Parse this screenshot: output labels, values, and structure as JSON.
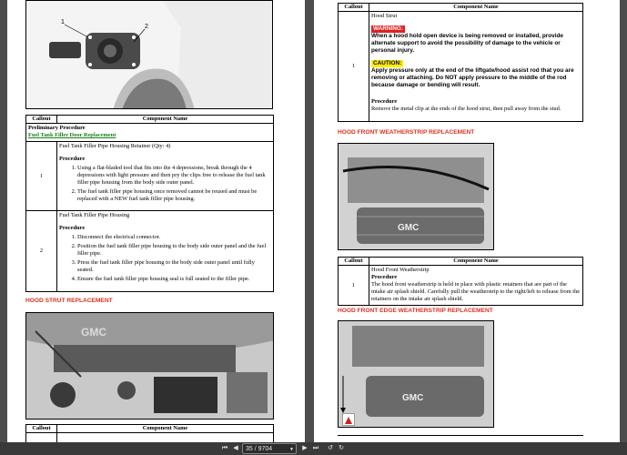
{
  "left_page": {
    "table1": {
      "headers": [
        "Callout",
        "Component Name"
      ],
      "preliminary_label": "Preliminary Procedure",
      "preliminary_link": "Fuel Tank Filler Door Replacement",
      "rows": [
        {
          "callout": "1",
          "component": "Fuel Tank Filler Pipe Housing Retainer (Qty: 4)",
          "procedure_label": "Procedure",
          "steps": [
            "Using a flat-bladed tool that fits into the 4 depressions, break through the 4 depressions with light pressure and then pry the clips free to release the fuel tank filler pipe housing from the body side outer panel.",
            "The fuel tank filler pipe housing once removed cannot be reused and must be replaced with a NEW fuel tank filler pipe housing."
          ]
        },
        {
          "callout": "2",
          "component": "Fuel Tank Filler Pipe Housing",
          "procedure_label": "Procedure",
          "steps": [
            "Disconnect the electrical connector.",
            "Position the fuel tank filler pipe housing to the body side outer panel and the fuel filler pipe.",
            "Press the fuel tank filler pipe housing to the body side outer panel until fully seated.",
            "Ensure the fuel tank filler pipe housing seal is full seated to the filler pipe."
          ]
        }
      ]
    },
    "section_hood_strut": "HOOD STRUT REPLACEMENT",
    "table2": {
      "headers": [
        "Callout",
        "Component Name"
      ]
    }
  },
  "right_page": {
    "table_strut": {
      "headers": [
        "Callout",
        "Component Name"
      ],
      "callout": "1",
      "component": "Hood Strut",
      "warning_label": "WARNING:",
      "warning_text": "When a hood hold open device is being removed or installed, provide alternate support to avoid the possibility of damage to the vehicle or personal injury.",
      "caution_label": "CAUTION:",
      "caution_text": "Apply pressure only at the end of the liftgate/hood assist rod that you are removing or attaching. Do NOT apply pressure to the middle of the rod because damage or bending will result.",
      "procedure_label": "Procedure",
      "procedure_text": "Remove the metal clip at the ends of the hood strut, then pull away from the stud."
    },
    "section_weatherstrip": "HOOD FRONT WEATHERSTRIP REPLACEMENT",
    "table_weatherstrip": {
      "headers": [
        "Callout",
        "Component Name"
      ],
      "callout": "1",
      "component": "Hood Front Weatherstrip",
      "procedure_label": "Procedure",
      "procedure_text": "The hood front weatherstrip is held in place with plastic retainers that are part of the intake air splash shield. Carefully pull the weatherstrip to the right/left to release from the retainers on the intake air splash shield."
    },
    "section_edge_weatherstrip": "HOOD FRONT EDGE WEATHERSTRIP REPLACEMENT",
    "callout_marker_icon": "callout-1-marker"
  },
  "toolbar": {
    "current_page": "35",
    "page_display": "35 / 9704",
    "total_pages": "9704",
    "icons": [
      "first-page-icon",
      "prev-page-icon",
      "page-dropdown-icon",
      "next-page-icon",
      "last-page-icon",
      "undo-icon",
      "redo-icon"
    ]
  },
  "colors": {
    "section_heading": "#e03020",
    "link": "#1a7f1a",
    "warning_bg": "#e02020",
    "caution_bg": "#ffee00",
    "viewer_bg": "#4d4d4d"
  }
}
